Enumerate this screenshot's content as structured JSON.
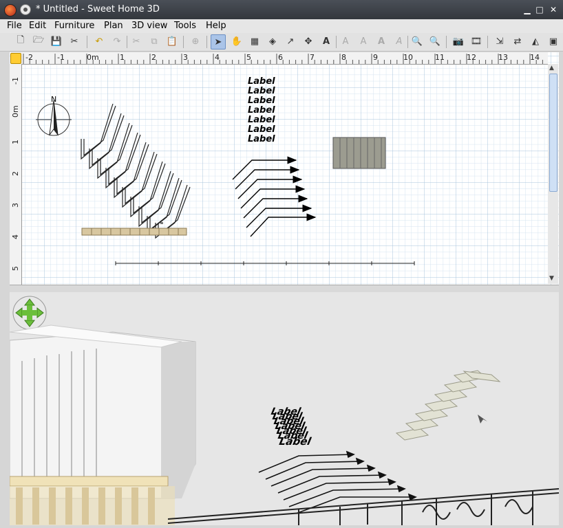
{
  "window": {
    "title": "* Untitled - Sweet Home 3D",
    "minimize_glyph": "▁",
    "maximize_glyph": "□",
    "close_glyph": "✕"
  },
  "menu": [
    "File",
    "Edit",
    "Furniture",
    "Plan",
    "3D view",
    "Tools",
    "Help"
  ],
  "toolbar": [
    {
      "icon": "new-home-icon",
      "glyph": "🗋"
    },
    {
      "icon": "open-icon",
      "glyph": "🗁"
    },
    {
      "icon": "save-icon",
      "glyph": "💾"
    },
    {
      "icon": "preferences-icon",
      "glyph": "✂"
    },
    {
      "icon": "undo-icon",
      "glyph": "↶"
    },
    {
      "icon": "redo-icon",
      "glyph": "↷"
    },
    {
      "icon": "cut-icon",
      "glyph": "✂"
    },
    {
      "icon": "copy-icon",
      "glyph": "⧉"
    },
    {
      "icon": "paste-icon",
      "glyph": "📋"
    },
    {
      "icon": "add-furniture-icon",
      "glyph": "⊕"
    },
    {
      "icon": "select-mode-icon",
      "glyph": "➤"
    },
    {
      "icon": "pan-mode-icon",
      "glyph": "✋"
    },
    {
      "icon": "create-walls-icon",
      "glyph": "▦"
    },
    {
      "icon": "create-rooms-icon",
      "glyph": "◈"
    },
    {
      "icon": "create-polylines-icon",
      "glyph": "↗"
    },
    {
      "icon": "create-dimensions-icon",
      "glyph": "✥"
    },
    {
      "icon": "add-text-icon",
      "glyph": "A"
    },
    {
      "icon": "text-style-1-icon",
      "glyph": "A"
    },
    {
      "icon": "text-style-2-icon",
      "glyph": "A"
    },
    {
      "icon": "bold-icon",
      "glyph": "A"
    },
    {
      "icon": "italic-icon",
      "glyph": "A"
    },
    {
      "icon": "zoom-in-icon",
      "glyph": "🔍"
    },
    {
      "icon": "zoom-out-icon",
      "glyph": "🔍"
    },
    {
      "icon": "create-photo-icon",
      "glyph": "📷"
    },
    {
      "icon": "create-video-icon",
      "glyph": "🎞"
    },
    {
      "icon": "import-furniture-icon",
      "glyph": "⇲"
    },
    {
      "icon": "import-textures-icon",
      "glyph": "⇄"
    },
    {
      "icon": "flip-icon",
      "glyph": "◭"
    },
    {
      "icon": "more-icon",
      "glyph": "▣"
    }
  ],
  "ruler": {
    "h_labels": [
      "-2",
      "-1",
      "0m",
      "1",
      "2",
      "3",
      "4",
      "5",
      "6",
      "7",
      "8",
      "9",
      "10",
      "11",
      "12",
      "13",
      "14"
    ],
    "v_labels": [
      "-1",
      "0m",
      "1",
      "2",
      "3",
      "4",
      "5"
    ]
  },
  "plan": {
    "labels": [
      "Label",
      "Label",
      "Label",
      "Label",
      "Label",
      "Label",
      "Label"
    ]
  },
  "view3d": {
    "labels": [
      "Label",
      "Label",
      "Label",
      "Label",
      "Label",
      "Label",
      "Label"
    ]
  }
}
